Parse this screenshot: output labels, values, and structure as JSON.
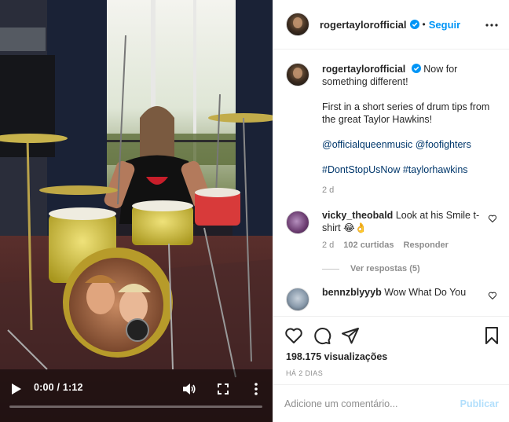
{
  "video": {
    "time_display": "0:00 / 1:12",
    "progress": 0.0
  },
  "header": {
    "username": "rogertaylorofficial",
    "separator": "•",
    "follow_label": "Seguir"
  },
  "caption": {
    "username": "rogertaylorofficial",
    "line1": "Now for something different!",
    "line2": "First in a short series of drum tips from the great Taylor Hawkins!",
    "mention1": "@officialqueenmusic",
    "mention2": "@foofighters",
    "hashtag1": "#DontStopUsNow",
    "hashtag2": "#taylorhawkins",
    "age": "2 d"
  },
  "comments": [
    {
      "username": "vicky_theobald",
      "text": "Look at his Smile t-shirt 😂👌",
      "age": "2 d",
      "likes": "102 curtidas",
      "reply_label": "Responder",
      "view_replies": "Ver respostas (5)"
    },
    {
      "username": "bennzblyyyb",
      "text": "Wow What Do You"
    }
  ],
  "stats": {
    "views": "198.175 visualizações",
    "posted": "HÁ 2 DIAS"
  },
  "composer": {
    "placeholder": "Adicione um comentário...",
    "publish_label": "Publicar"
  },
  "colors": {
    "link": "#00376b",
    "accent": "#0095f6",
    "publish_disabled": "#b2dffc",
    "muted": "#8e8e8e"
  },
  "icons": [
    "play-icon",
    "volume-icon",
    "fullscreen-icon",
    "more-vertical-icon",
    "more-horizontal-icon",
    "verified-icon",
    "heart-icon",
    "comment-icon",
    "share-icon",
    "bookmark-icon"
  ]
}
